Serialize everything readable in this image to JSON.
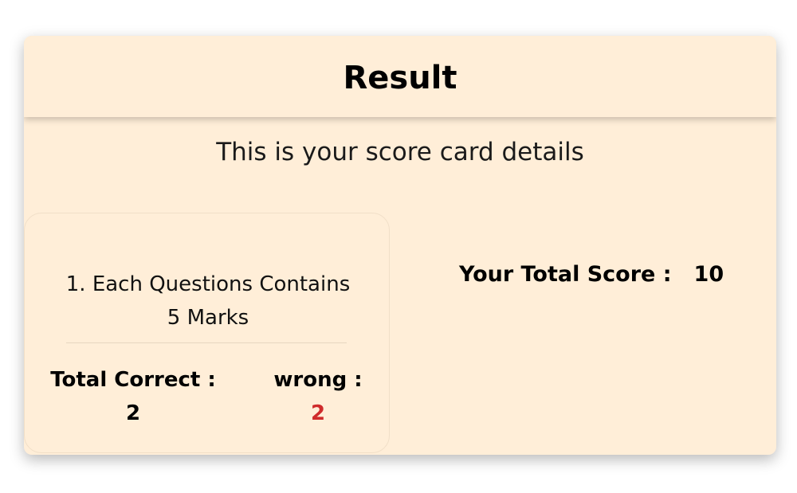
{
  "card": {
    "title": "Result",
    "subtitle": "This is your score card details"
  },
  "rules": {
    "text": "1. Each Questions Contains 5 Marks"
  },
  "stats": {
    "correct_label": "Total Correct :",
    "correct_value": "2",
    "wrong_label": "wrong :",
    "wrong_value": "2"
  },
  "score": {
    "label": "Your Total Score :",
    "value": "10"
  },
  "colors": {
    "card_background": "#ffeed8",
    "wrong_value": "#cf2b2b"
  }
}
